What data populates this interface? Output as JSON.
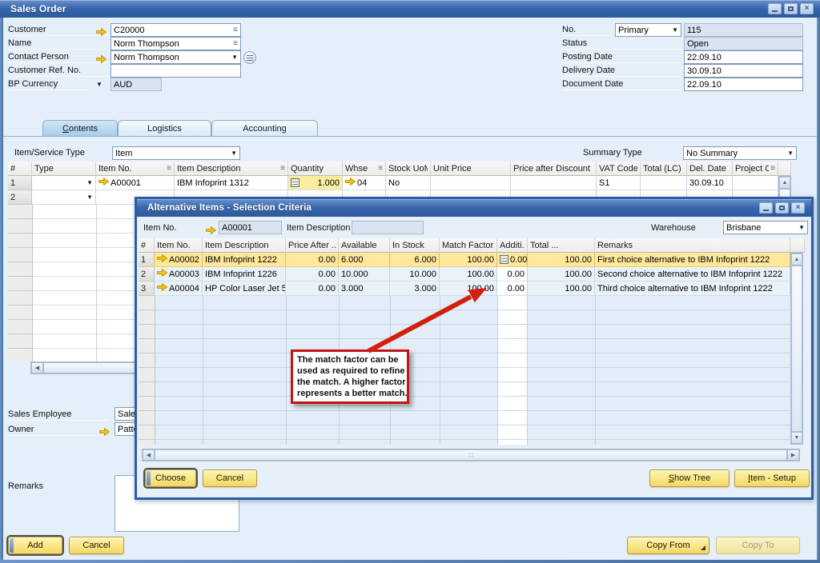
{
  "icons": {
    "dropdown": "▼",
    "sort": "≡",
    "link_note": "≡",
    "close": "×",
    "scroll_up": "▲",
    "scroll_down": "▼",
    "scroll_left": "◀",
    "scroll_right": "▶",
    "grip": "∷"
  },
  "colors": {
    "titlebar_blue": "#2f5fae",
    "selection_yellow": "#ffe79b",
    "button_yellow": "#f8dc6e",
    "annotation_red": "#c41414",
    "link_arrow_orange": "#f6c20a"
  },
  "window": {
    "title": "Sales Order"
  },
  "header": {
    "customer": {
      "label": "Customer",
      "value": "C20000"
    },
    "name": {
      "label": "Name",
      "value": "Norm Thompson"
    },
    "contact_person": {
      "label": "Contact Person",
      "value": "Norm Thompson"
    },
    "customer_ref": {
      "label": "Customer Ref. No.",
      "value": ""
    },
    "bp_currency": {
      "label": "BP Currency",
      "value": "AUD"
    },
    "no": {
      "label": "No.",
      "series": "Primary",
      "value": "115"
    },
    "status": {
      "label": "Status",
      "value": "Open"
    },
    "posting_date": {
      "label": "Posting Date",
      "value": "22.09.10"
    },
    "delivery_date": {
      "label": "Delivery Date",
      "value": "30.09.10"
    },
    "document_date": {
      "label": "Document Date",
      "value": "22.09.10"
    }
  },
  "tabs": [
    {
      "label": "Contents",
      "accel": "C"
    },
    {
      "label": "Logistics",
      "accel": ""
    },
    {
      "label": "Accounting",
      "accel": ""
    }
  ],
  "toolbar": {
    "item_service_type_label": "Item/Service Type",
    "item_service_type_value": "Item",
    "summary_type_label": "Summary Type",
    "summary_type_value": "No Summary"
  },
  "main_grid": {
    "columns": [
      "#",
      "Type",
      "Item No.",
      "Item Description",
      "Quantity",
      "Whse",
      "Stock UoM",
      "Unit Price",
      "Price after Discount",
      "VAT Code",
      "Total (LC)",
      "Del. Date",
      "Project C..."
    ],
    "rows": [
      {
        "num": "1",
        "item_no": "A00001",
        "item_description": "IBM Infoprint 1312",
        "quantity": "1.000",
        "whse": "04",
        "stock_uom": "No",
        "unit_price": "",
        "price_after_discount": "",
        "vat_code": "S1",
        "total_lc": "",
        "del_date": "30.09.10",
        "project": ""
      },
      {
        "num": "2",
        "item_no": "",
        "item_description": "",
        "quantity": "",
        "whse": "",
        "stock_uom": "",
        "unit_price": "",
        "price_after_discount": "",
        "vat_code": "",
        "total_lc": "",
        "del_date": "",
        "project": ""
      }
    ]
  },
  "footer": {
    "sales_employee": {
      "label": "Sales Employee",
      "value": "Sales"
    },
    "owner": {
      "label": "Owner",
      "value": "Patte"
    },
    "remarks": {
      "label": "Remarks",
      "value": ""
    },
    "add_button": {
      "label": "Add",
      "accel": ""
    },
    "cancel_button": {
      "label": "Cancel",
      "accel": ""
    },
    "copy_from_button": {
      "label": "Copy From",
      "accel": ""
    },
    "copy_to_button": {
      "label": "Copy To",
      "accel": ""
    }
  },
  "dialog": {
    "title": "Alternative Items - Selection Criteria",
    "item_no": {
      "label": "Item No.",
      "value": "A00001"
    },
    "item_description": {
      "label": "Item Description",
      "value": ""
    },
    "warehouse": {
      "label": "Warehouse",
      "value": "Brisbane"
    },
    "grid": {
      "columns": [
        "#",
        "Item No.",
        "Item Description",
        "Price After ...",
        "Available",
        "In Stock",
        "Match Factor",
        "Additi...",
        "Total ...",
        "Remarks"
      ],
      "rows": [
        {
          "num": "1",
          "item_no": "A00002",
          "item_description": "IBM Infoprint 1222",
          "price_after": "0.00",
          "available": "6.000",
          "in_stock": "6.000",
          "match_factor": "100.00",
          "additional": "0.00",
          "total": "100.00",
          "remarks": "First choice alternative to IBM Infoprint 1222"
        },
        {
          "num": "2",
          "item_no": "A00003",
          "item_description": "IBM Infoprint 1226",
          "price_after": "0.00",
          "available": "10.000",
          "in_stock": "10.000",
          "match_factor": "100.00",
          "additional": "0.00",
          "total": "100.00",
          "remarks": "Second choice alternative to IBM Infoprint 1222"
        },
        {
          "num": "3",
          "item_no": "A00004",
          "item_description": "HP Color Laser Jet 5",
          "price_after": "0.00",
          "available": "3.000",
          "in_stock": "3.000",
          "match_factor": "100.00",
          "additional": "0.00",
          "total": "100.00",
          "remarks": "Third choice alternative to IBM Infoprint 1222"
        }
      ]
    },
    "buttons": {
      "choose": {
        "label": "Choose",
        "accel": ""
      },
      "cancel": {
        "label": "Cancel",
        "accel": ""
      },
      "show_tree": {
        "label": "Show Tree",
        "accel": "S"
      },
      "item_setup": {
        "label": "Item - Setup",
        "accel": "I"
      }
    }
  },
  "annotation": {
    "lines": [
      "The match factor can be",
      "used as required to refine",
      "the match. A higher factor",
      "represents a better match."
    ]
  }
}
